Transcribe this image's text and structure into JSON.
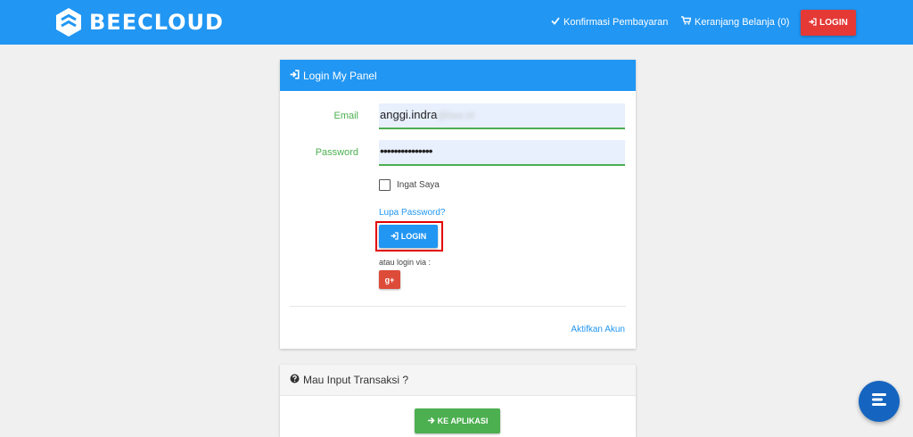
{
  "header": {
    "brand": "BEECLOUD",
    "nav": {
      "confirm_payment": "Konfirmasi Pembayaran",
      "cart": "Keranjang Belanja (0)",
      "login": "LOGIN"
    },
    "colors": {
      "bar": "#2196f3",
      "login_button": "#e53935"
    }
  },
  "login_panel": {
    "title": "Login My Panel",
    "email": {
      "label": "Email",
      "value": "anggi.indra",
      "obscured": "@bee.id"
    },
    "password": {
      "label": "Password",
      "masked_value": "•••••••••••••••"
    },
    "remember_me": {
      "label": "Ingat Saya",
      "checked": false
    },
    "forgot_password": "Lupa Password?",
    "login_button": "LOGIN",
    "alt_login": "atau login via :",
    "google_button": "g+",
    "activate_account": "Aktifkan Akun"
  },
  "transaction_panel": {
    "title": "Mau Input Transaksi ?",
    "app_button": "KE APLIKASI"
  },
  "icons": [
    "beecloud-logo-icon",
    "check-icon",
    "cart-icon",
    "sign-in-icon",
    "question-circle-icon",
    "arrow-right-icon",
    "chat-icon"
  ]
}
